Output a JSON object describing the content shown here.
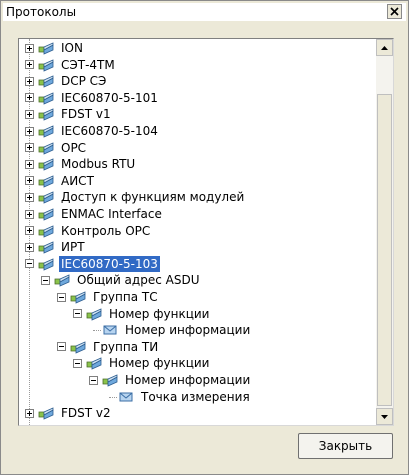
{
  "window": {
    "title": "Протоколы"
  },
  "tree": {
    "nodes": [
      {
        "label": "ION",
        "level": 0,
        "expander": "plus",
        "icon": "network-node-icon"
      },
      {
        "label": "СЭТ-4ТМ",
        "level": 0,
        "expander": "plus",
        "icon": "network-node-icon"
      },
      {
        "label": "DCP СЭ",
        "level": 0,
        "expander": "plus",
        "icon": "network-node-icon"
      },
      {
        "label": "IEC60870-5-101",
        "level": 0,
        "expander": "plus",
        "icon": "network-node-icon"
      },
      {
        "label": "FDST v1",
        "level": 0,
        "expander": "plus",
        "icon": "network-node-icon"
      },
      {
        "label": "IEC60870-5-104",
        "level": 0,
        "expander": "plus",
        "icon": "network-node-icon"
      },
      {
        "label": "OPC",
        "level": 0,
        "expander": "plus",
        "icon": "network-node-icon"
      },
      {
        "label": "Modbus RTU",
        "level": 0,
        "expander": "plus",
        "icon": "network-node-icon"
      },
      {
        "label": "АИСТ",
        "level": 0,
        "expander": "plus",
        "icon": "network-node-icon"
      },
      {
        "label": "Доступ к функциям модулей",
        "level": 0,
        "expander": "plus",
        "icon": "network-node-icon"
      },
      {
        "label": "ENMAC Interface",
        "level": 0,
        "expander": "plus",
        "icon": "network-node-icon"
      },
      {
        "label": "Контроль OPC",
        "level": 0,
        "expander": "plus",
        "icon": "network-node-icon"
      },
      {
        "label": "ИРТ",
        "level": 0,
        "expander": "plus",
        "icon": "network-node-icon"
      },
      {
        "label": "IEC60870-5-103",
        "level": 0,
        "expander": "minus",
        "icon": "network-node-icon",
        "selected": true
      },
      {
        "label": "Общий адрес ASDU",
        "level": 1,
        "expander": "minus",
        "icon": "network-node-icon"
      },
      {
        "label": "Группа ТС",
        "level": 2,
        "expander": "minus",
        "icon": "network-node-icon"
      },
      {
        "label": "Номер функции",
        "level": 3,
        "expander": "minus",
        "icon": "network-node-icon"
      },
      {
        "label": "Номер информации",
        "level": 4,
        "expander": "none",
        "icon": "envelope-icon"
      },
      {
        "label": "Группа ТИ",
        "level": 2,
        "expander": "minus",
        "icon": "network-node-icon"
      },
      {
        "label": "Номер функции",
        "level": 3,
        "expander": "minus",
        "icon": "network-node-icon"
      },
      {
        "label": "Номер информации",
        "level": 4,
        "expander": "minus",
        "icon": "network-node-icon"
      },
      {
        "label": "Точка измерения",
        "level": 5,
        "expander": "none",
        "icon": "envelope-icon"
      },
      {
        "label": "FDST v2",
        "level": 0,
        "expander": "plus",
        "icon": "network-node-icon"
      }
    ]
  },
  "scrollbar": {
    "up_icon": "arrow-up-icon",
    "down_icon": "arrow-down-icon"
  },
  "footer": {
    "close_label": "Закрыть"
  }
}
